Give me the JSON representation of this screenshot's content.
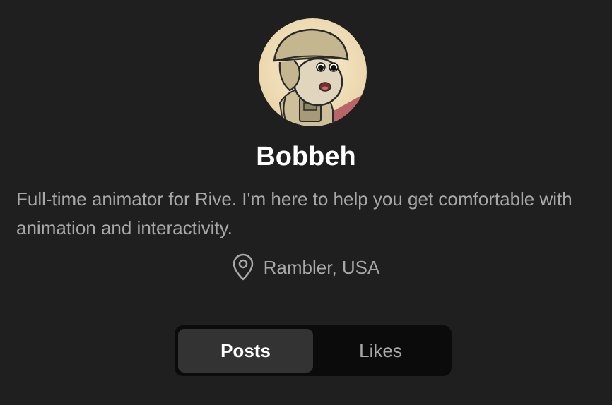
{
  "profile": {
    "avatar_icon": "soldier-avatar",
    "name": "Bobbeh",
    "bio": "Full-time animator for Rive. I'm here to help you get comfortable with animation and interactivity.",
    "location": {
      "icon": "map-pin-icon",
      "text": "Rambler, USA"
    }
  },
  "tabs": {
    "items": [
      {
        "label": "Posts",
        "active": true
      },
      {
        "label": "Likes",
        "active": false
      }
    ]
  },
  "colors": {
    "background": "#1f1f1f",
    "tab_track": "#0b0b0b",
    "tab_active": "#333333",
    "muted_text": "#a8a8a8",
    "name_text": "#ffffff"
  }
}
